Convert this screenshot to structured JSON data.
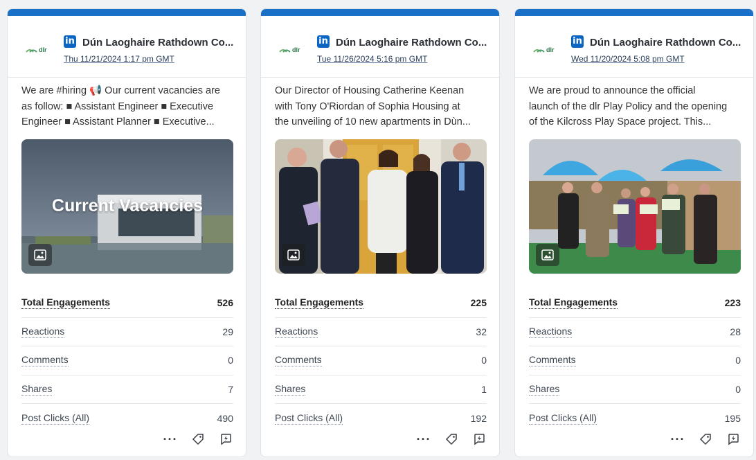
{
  "colors": {
    "accent_bar": "#1a6fc7",
    "linkedin": "#0a66c2"
  },
  "cards": [
    {
      "account_name": "Dún Laoghaire Rathdown Co...",
      "post_date": "Thu 11/21/2024 1:17 pm GMT",
      "text_lines": [
        "We are #hiring 📢 Our current vacancies are",
        "as follow: ■ Assistant Engineer ■ Executive",
        "Engineer ■ Assistant Planner ■ Executive..."
      ],
      "image_overlay_title": "Current Vacancies",
      "stats": {
        "total_label": "Total Engagements",
        "total_value": "526",
        "reactions_label": "Reactions",
        "reactions_value": "29",
        "comments_label": "Comments",
        "comments_value": "0",
        "shares_label": "Shares",
        "shares_value": "7",
        "clicks_label": "Post Clicks (All)",
        "clicks_value": "490"
      },
      "actions": {
        "more": "···"
      }
    },
    {
      "account_name": "Dún Laoghaire Rathdown Co...",
      "post_date": "Tue 11/26/2024 5:16 pm GMT",
      "text_lines": [
        "Our Director of Housing Catherine Keenan",
        "with Tony O'Riordan of Sophia Housing at",
        "the unveiling of 10 new apartments in Dùn..."
      ],
      "stats": {
        "total_label": "Total Engagements",
        "total_value": "225",
        "reactions_label": "Reactions",
        "reactions_value": "32",
        "comments_label": "Comments",
        "comments_value": "0",
        "shares_label": "Shares",
        "shares_value": "1",
        "clicks_label": "Post Clicks (All)",
        "clicks_value": "192"
      },
      "actions": {
        "more": "···"
      }
    },
    {
      "account_name": "Dún Laoghaire Rathdown Co...",
      "post_date": "Wed 11/20/2024 5:08 pm GMT",
      "text_lines": [
        "We are proud to announce the official",
        "launch of the dlr Play Policy and the opening",
        "of the Kilcross Play Space project. This..."
      ],
      "stats": {
        "total_label": "Total Engagements",
        "total_value": "223",
        "reactions_label": "Reactions",
        "reactions_value": "28",
        "comments_label": "Comments",
        "comments_value": "0",
        "shares_label": "Shares",
        "shares_value": "0",
        "clicks_label": "Post Clicks (All)",
        "clicks_value": "195"
      },
      "actions": {
        "more": "···"
      }
    }
  ],
  "logo_text": "dlr",
  "linkedin_badge": "in"
}
